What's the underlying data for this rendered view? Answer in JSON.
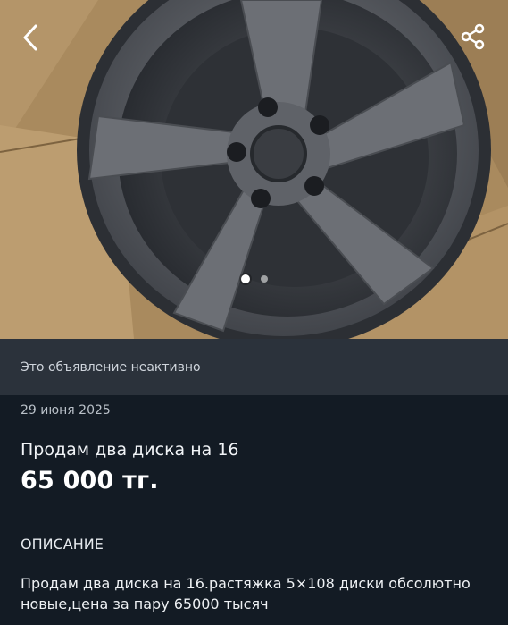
{
  "photo": {
    "icons": {
      "back": "chevron-left-icon",
      "share": "share-icon"
    },
    "pager": {
      "count": 2,
      "active": 1
    }
  },
  "banner": {
    "text": "Это объявление неактивно"
  },
  "listing": {
    "date": "29 июня 2025",
    "title": "Продам два диска на 16",
    "price": "65 000 тг.",
    "description_heading": "ОПИСАНИЕ",
    "description": "Продам два диска на 16.растяжка 5×108 диски обсолютно новые,цена за пару 65000 тысяч"
  },
  "colors": {
    "background": "#131b24",
    "banner": "#2b323b"
  }
}
